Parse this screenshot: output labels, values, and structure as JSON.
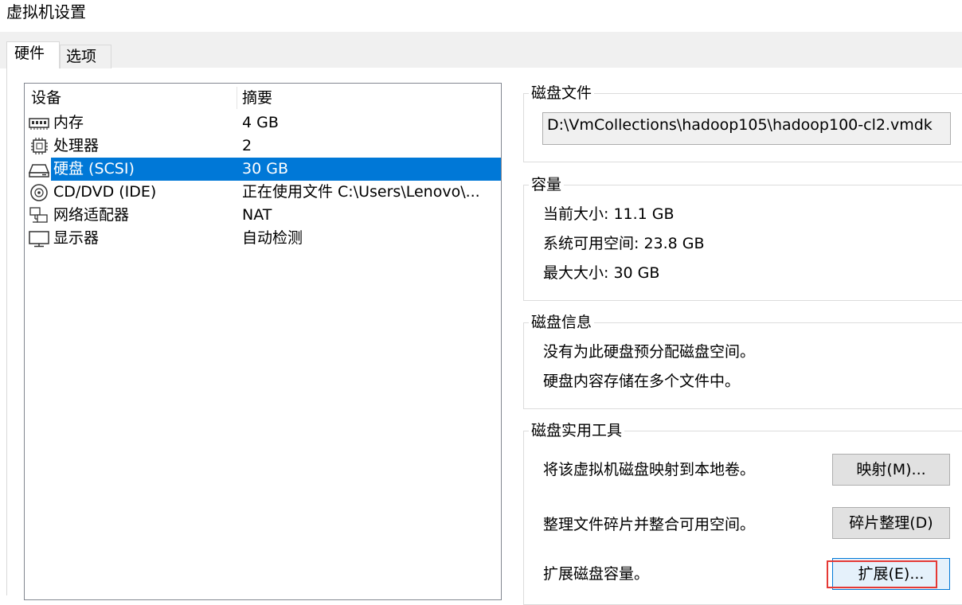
{
  "window": {
    "title": "虚拟机设置"
  },
  "tabs": [
    {
      "label": "硬件",
      "active": true
    },
    {
      "label": "选项",
      "active": false
    }
  ],
  "device_list": {
    "columns": {
      "device": "设备",
      "summary": "摘要"
    },
    "rows": [
      {
        "icon": "memory-icon",
        "name": "内存",
        "summary": "4 GB",
        "selected": false
      },
      {
        "icon": "processor-icon",
        "name": "处理器",
        "summary": "2",
        "selected": false
      },
      {
        "icon": "hard-disk-icon",
        "name": "硬盘 (SCSI)",
        "summary": "30 GB",
        "selected": true
      },
      {
        "icon": "cd-dvd-icon",
        "name": "CD/DVD (IDE)",
        "summary": "正在使用文件 C:\\Users\\Lenovo\\...",
        "selected": false
      },
      {
        "icon": "network-adapter-icon",
        "name": "网络适配器",
        "summary": "NAT",
        "selected": false
      },
      {
        "icon": "display-icon",
        "name": "显示器",
        "summary": "自动检测",
        "selected": false
      }
    ]
  },
  "disk_file": {
    "legend": "磁盘文件",
    "path": "D:\\VmCollections\\hadoop105\\hadoop100-cl2.vmdk"
  },
  "capacity": {
    "legend": "容量",
    "current_size": "当前大小: 11.1 GB",
    "system_free": "系统可用空间: 23.8 GB",
    "max_size": "最大大小: 30 GB"
  },
  "disk_info": {
    "legend": "磁盘信息",
    "line1": "没有为此硬盘预分配磁盘空间。",
    "line2": "硬盘内容存储在多个文件中。"
  },
  "disk_utilities": {
    "legend": "磁盘实用工具",
    "map_desc": "将该虚拟机磁盘映射到本地卷。",
    "map_button": "映射(M)...",
    "defrag_desc": "整理文件碎片并整合可用空间。",
    "defrag_button": "碎片整理(D)",
    "expand_desc": "扩展磁盘容量。",
    "expand_button": "扩展(E)..."
  },
  "colors": {
    "selection": "#0078d7",
    "highlight_box": "#e53935",
    "tab_strip": "#f0f0f0"
  }
}
